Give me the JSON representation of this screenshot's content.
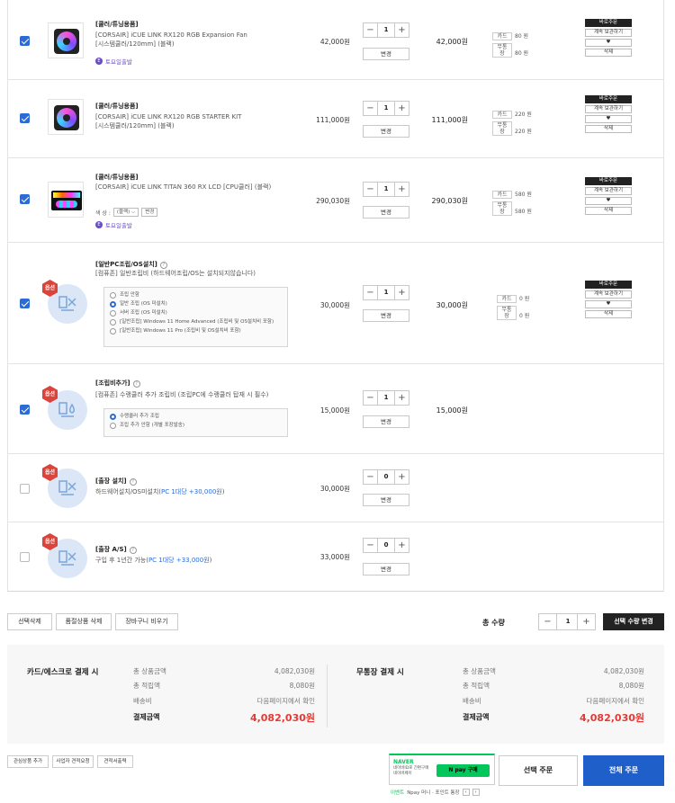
{
  "items": [
    {
      "checked": true,
      "category": "[쿨러/튜닝용품]",
      "name_lines": [
        "[CORSAIR] iCUE LINK RX120 RGB Expansion Fan",
        "[시스템쿨러/120mm] (블랙)"
      ],
      "badge": "토요일출발",
      "price": "42,000원",
      "qty": "1",
      "change": "변경",
      "total": "42,000원",
      "points": [
        {
          "label": "카드",
          "value": "80 원"
        },
        {
          "label": "무통장",
          "value": "80 원"
        }
      ],
      "actions": [
        "바로주문",
        "계속 보관하기",
        "♥",
        "삭제"
      ]
    },
    {
      "checked": true,
      "category": "[쿨러/튜닝용품]",
      "name_lines": [
        "[CORSAIR] iCUE LINK RX120 RGB STARTER KIT",
        "[시스템쿨러/120mm] (블랙)"
      ],
      "price": "111,000원",
      "qty": "1",
      "change": "변경",
      "total": "111,000원",
      "points": [
        {
          "label": "카드",
          "value": "220 원"
        },
        {
          "label": "무통장",
          "value": "220 원"
        }
      ],
      "actions": [
        "바로주문",
        "계속 보관하기",
        "♥",
        "삭제"
      ]
    },
    {
      "checked": true,
      "category": "[쿨러/튜닝용품]",
      "name_lines": [
        "[CORSAIR] iCUE LINK TITAN 360 RX LCD [CPU쿨러] (블랙)"
      ],
      "select_label": "색 상 :",
      "select_value": "(블랙)",
      "select_change": "변경",
      "badge": "토요일출발",
      "price": "290,030원",
      "qty": "1",
      "change": "변경",
      "total": "290,030원",
      "points": [
        {
          "label": "카드",
          "value": "580 원"
        },
        {
          "label": "무통장",
          "value": "580 원"
        }
      ],
      "actions": [
        "바로주문",
        "계속 보관하기",
        "♥",
        "삭제"
      ]
    },
    {
      "checked": true,
      "option_badge": "옵션",
      "category": "[일반PC조립/OS설치]",
      "name_lines": [
        "[컴퓨존] 일반조립비 (하드웨어조립/OS는 설치되지않습니다)"
      ],
      "options": [
        "조립 안함",
        "일반 조립 (OS 미설치)",
        "서버 조립 (OS 미설치)",
        "[일반조립] Windows 11 Home Advanced (조립비 및 OS설치비 포함)",
        "[일반조립] Windows 11 Pro (조립비 및 OS설치비 포함)"
      ],
      "selected_option": 1,
      "price": "30,000원",
      "qty": "1",
      "change": "변경",
      "total": "30,000원",
      "points": [
        {
          "label": "카드",
          "value": "0 원"
        },
        {
          "label": "무통장",
          "value": "0 원"
        }
      ],
      "actions": [
        "바로주문",
        "계속 보관하기",
        "♥",
        "삭제"
      ]
    },
    {
      "checked": true,
      "option_badge": "옵션",
      "category": "[조립비추가]",
      "name_lines": [
        "[컴퓨존] 수랭쿨러 추가 조립비 (조립PC에 수랭쿨러 탑재 시 필수)"
      ],
      "options": [
        "수랭쿨러 추가 조립",
        "조립 추가 안함 (개별 포장발송)"
      ],
      "selected_option": 0,
      "price": "15,000원",
      "qty": "1",
      "change": "변경",
      "total": "15,000원"
    },
    {
      "checked": false,
      "option_badge": "옵션",
      "category": "[출장 설치]",
      "name_plain": "하드웨어설치/OS미설치(",
      "name_blue": "PC 1대당 +30,000원",
      "name_end": ")",
      "price": "30,000원",
      "qty": "0",
      "change": "변경"
    },
    {
      "checked": false,
      "option_badge": "옵션",
      "category": "[출장 A/S]",
      "name_plain": "구입 후 1년간 가능(",
      "name_blue": "PC 1대당 +33,000원",
      "name_end": ")",
      "price": "33,000원",
      "qty": "0",
      "change": "변경"
    }
  ],
  "bottom_buttons": [
    "선택삭제",
    "품절상품 삭제",
    "장바구니 비우기"
  ],
  "total_qty": {
    "label": "총 수량",
    "value": "1",
    "button": "선택 수량 변경"
  },
  "summary": {
    "card": {
      "title": "카드/에스크로 결제 시",
      "rows": [
        {
          "label": "총 상품금액",
          "value": "4,082,030원"
        },
        {
          "label": "총 적립액",
          "value": "8,080원"
        },
        {
          "label": "배송비",
          "value": "다음페이지에서 확인"
        }
      ],
      "pay_label": "결제금액",
      "pay_value": "4,082,030원"
    },
    "bank": {
      "title": "무통장 결제 시",
      "rows": [
        {
          "label": "총 상품금액",
          "value": "4,082,030원"
        },
        {
          "label": "총 적립액",
          "value": "8,080원"
        },
        {
          "label": "배송비",
          "value": "다음페이지에서 확인"
        }
      ],
      "pay_label": "결제금액",
      "pay_value": "4,082,030원"
    }
  },
  "footer_buttons": [
    "관심상품 추가",
    "사업자 견적요청",
    "견적서출력"
  ],
  "naver": {
    "brand": "NAVER",
    "desc_lines": [
      "네이버ID로 간편구매",
      "네이버페이"
    ],
    "pay_label": "N pay 구매",
    "event": "이벤트",
    "event_text": "Npay 머니 · 포인트 통장"
  },
  "select_order": "선택 주문",
  "all_order": "전체 주문",
  "colors": {
    "accent": "#2b6bd6",
    "dark": "#222222",
    "red": "#e53935",
    "naver_green": "#03c75a"
  }
}
